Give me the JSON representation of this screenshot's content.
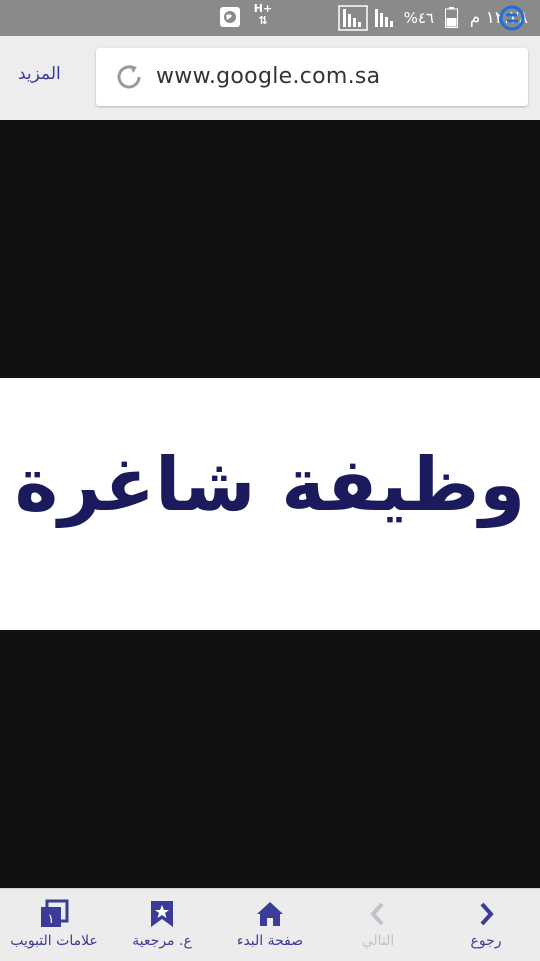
{
  "status_bar": {
    "time": "١٢:٢٨ م",
    "battery": "%٤٦",
    "network": "H+"
  },
  "browser": {
    "more_label": "المزيد",
    "url": "www.google.com.sa"
  },
  "content": {
    "banner_text": "وظيفة شاغرة"
  },
  "bottom_nav": [
    {
      "label": "رجوع",
      "icon": "chevron-right-icon",
      "enabled": true
    },
    {
      "label": "التالي",
      "icon": "chevron-left-icon",
      "enabled": false
    },
    {
      "label": "صفحة البدء",
      "icon": "home-icon",
      "enabled": true
    },
    {
      "label": "ع. مرجعية",
      "icon": "bookmark-icon",
      "enabled": true
    },
    {
      "label": "علامات التبويب",
      "icon": "tabs-icon",
      "enabled": true,
      "badge": "١"
    }
  ],
  "colors": {
    "accent": "#3b3b9a",
    "banner_text": "#1a1a5c",
    "status_bar": "#8a8a8a"
  }
}
